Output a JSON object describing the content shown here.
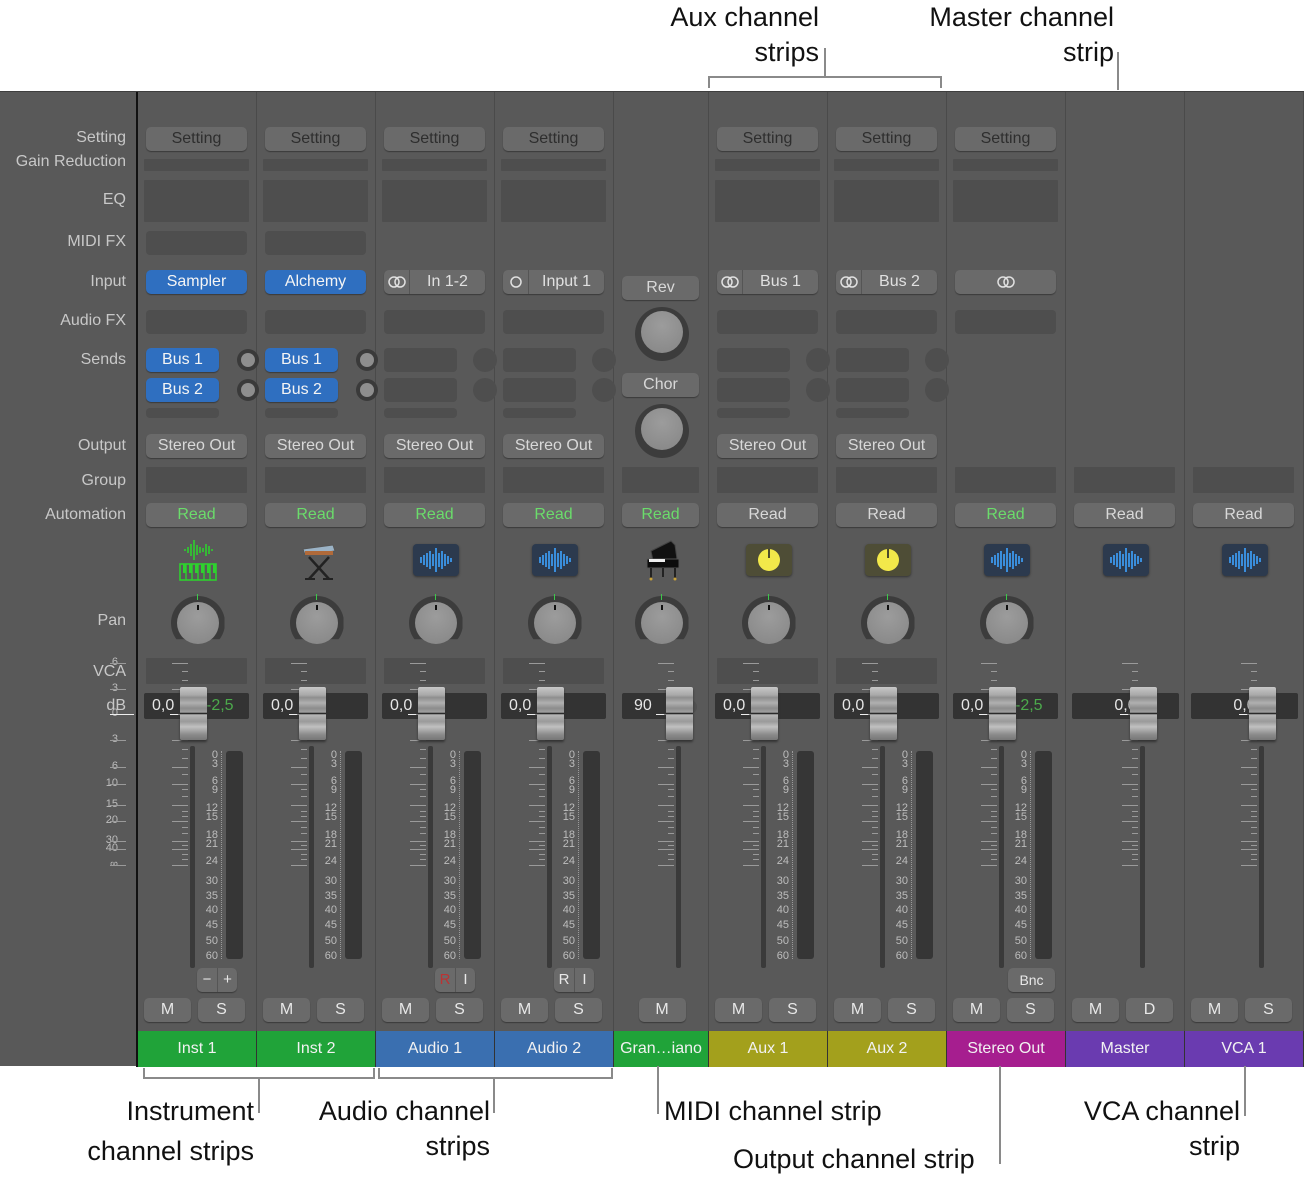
{
  "annotations": {
    "top": [
      {
        "id": "aux",
        "text_line1": "Aux channel",
        "text_line2": "strips"
      },
      {
        "id": "master",
        "text_line1": "Master channel",
        "text_line2": "strip"
      }
    ],
    "bottom": [
      {
        "id": "instrument",
        "text_line1": "Instrument",
        "text_line2": "channel strips"
      },
      {
        "id": "audio",
        "text_line1": "Audio channel",
        "text_line2": "strips"
      },
      {
        "id": "midi",
        "text_line1": "MIDI channel strip"
      },
      {
        "id": "output",
        "text_line1": "Output channel strip"
      },
      {
        "id": "vca",
        "text_line1": "VCA channel",
        "text_line2": "strip"
      }
    ]
  },
  "row_labels": {
    "setting": "Setting",
    "gain_reduction": "Gain Reduction",
    "eq": "EQ",
    "midi_fx": "MIDI FX",
    "input": "Input",
    "audio_fx": "Audio FX",
    "sends": "Sends",
    "output": "Output",
    "group": "Group",
    "automation": "Automation",
    "pan": "Pan",
    "vca": "VCA",
    "db": "dB"
  },
  "master_scale": [
    "6",
    "3",
    "0",
    "3",
    "6",
    "10",
    "15",
    "20",
    "30",
    "40",
    "∞"
  ],
  "meter_scale": [
    "0",
    "3",
    "6",
    "9",
    "12",
    "15",
    "18",
    "21",
    "24",
    "30",
    "35",
    "40",
    "45",
    "50",
    "60"
  ],
  "colors": {
    "instrument": "#20a339",
    "audio": "#3a6fb0",
    "midi": "#20a339",
    "aux": "#a3a01c",
    "output": "#a61e8f",
    "master": "#6a3bb0",
    "vca": "#6a3bb0",
    "automation_read_active": "#6bdc6b",
    "send_blue": "#2f6fc0"
  },
  "strips": [
    {
      "name": "Inst 1",
      "type": "instrument",
      "setting": "Setting",
      "input": {
        "label": "Sampler",
        "style": "blue"
      },
      "sends": [
        {
          "label": "Bus 1"
        },
        {
          "label": "Bus 2"
        }
      ],
      "output": "Stereo Out",
      "automation": "Read",
      "automation_active": true,
      "icon": "instrument-waveform-keyboard-icon",
      "volume": "0,0",
      "peak": "-2,5",
      "buttons": [
        "M",
        "S"
      ],
      "extra": [
        "−",
        "+"
      ]
    },
    {
      "name": "Inst 2",
      "type": "instrument",
      "setting": "Setting",
      "input": {
        "label": "Alchemy",
        "style": "blue"
      },
      "sends": [
        {
          "label": "Bus 1"
        },
        {
          "label": "Bus 2"
        }
      ],
      "output": "Stereo Out",
      "automation": "Read",
      "automation_active": true,
      "icon": "keyboard-stand-icon",
      "volume": "0,0",
      "peak": "",
      "buttons": [
        "M",
        "S"
      ]
    },
    {
      "name": "Audio 1",
      "type": "audio",
      "setting": "Setting",
      "input": {
        "label": "In 1-2",
        "format": "stereo"
      },
      "output": "Stereo Out",
      "automation": "Read",
      "automation_active": true,
      "icon": "audio-waveform-icon",
      "volume": "0,0",
      "peak": "",
      "buttons": [
        "M",
        "S"
      ],
      "extra": [
        "R",
        "I"
      ]
    },
    {
      "name": "Audio 2",
      "type": "audio",
      "setting": "Setting",
      "input": {
        "label": "Input 1",
        "format": "mono"
      },
      "output": "Stereo Out",
      "automation": "Read",
      "automation_active": true,
      "icon": "audio-waveform-icon",
      "volume": "0,0",
      "peak": "",
      "buttons": [
        "M",
        "S"
      ],
      "extra": [
        "R",
        "I"
      ]
    },
    {
      "name": "Gran…iano",
      "type": "midi",
      "midi_controls": [
        {
          "label": "Rev"
        },
        {
          "label": "Chor"
        }
      ],
      "automation": "Read",
      "automation_active": true,
      "icon": "grand-piano-icon",
      "volume": "90",
      "buttons": [
        "M"
      ]
    },
    {
      "name": "Aux 1",
      "type": "aux",
      "setting": "Setting",
      "input": {
        "label": "Bus 1",
        "format": "stereo"
      },
      "output": "Stereo Out",
      "automation": "Read",
      "automation_active": false,
      "icon": "aux-knob-icon",
      "volume": "0,0",
      "peak": "",
      "buttons": [
        "M",
        "S"
      ]
    },
    {
      "name": "Aux 2",
      "type": "aux",
      "setting": "Setting",
      "input": {
        "label": "Bus 2",
        "format": "stereo"
      },
      "output": "Stereo Out",
      "automation": "Read",
      "automation_active": false,
      "icon": "aux-knob-icon",
      "volume": "0,0",
      "peak": "",
      "buttons": [
        "M",
        "S"
      ]
    },
    {
      "name": "Stereo Out",
      "type": "output",
      "setting": "Setting",
      "input": {
        "label": "",
        "format": "stereo"
      },
      "automation": "Read",
      "automation_active": true,
      "icon": "audio-waveform-icon",
      "volume": "0,0",
      "peak": "-2,5",
      "buttons": [
        "M",
        "S"
      ],
      "bounce": "Bnc"
    },
    {
      "name": "Master",
      "type": "master",
      "automation": "Read",
      "automation_active": false,
      "icon": "audio-waveform-icon",
      "volume": "0,0",
      "buttons": [
        "M",
        "D"
      ]
    },
    {
      "name": "VCA 1",
      "type": "vca",
      "automation": "Read",
      "automation_active": false,
      "icon": "audio-waveform-icon",
      "volume": "0,0",
      "buttons": [
        "M",
        "S"
      ]
    }
  ]
}
